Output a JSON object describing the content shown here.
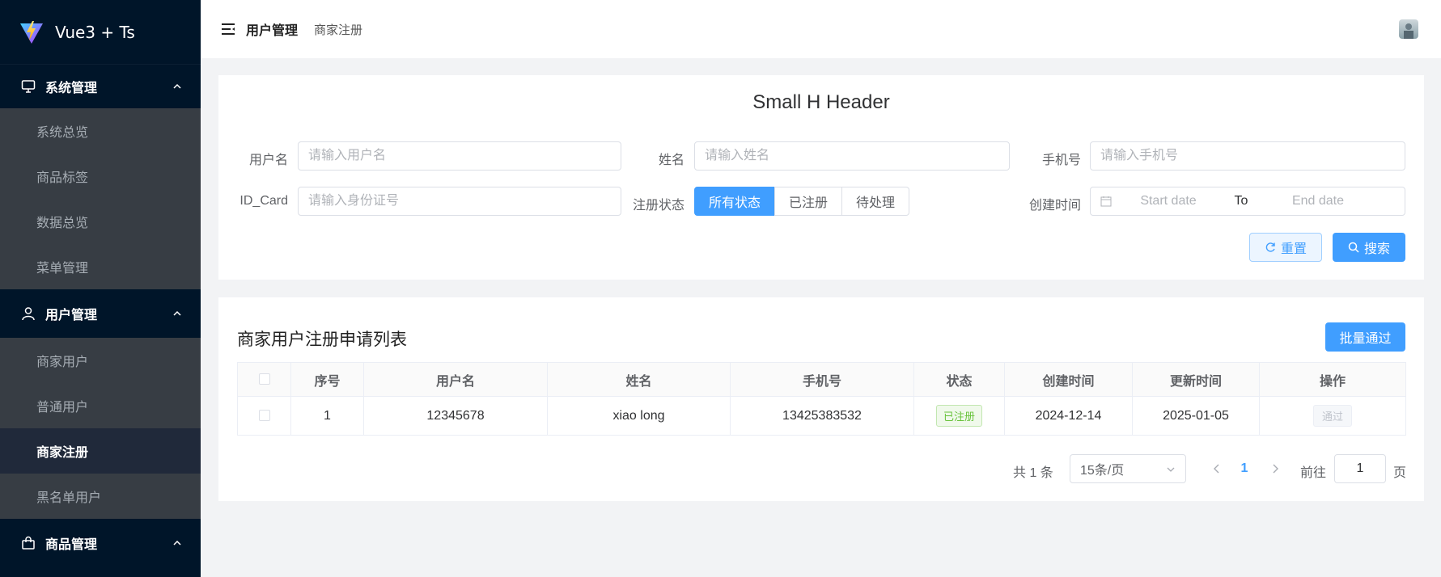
{
  "app": {
    "title": "Vue3 + Ts"
  },
  "sidebar": {
    "groups": [
      {
        "label": "系统管理",
        "icon": "monitor-icon",
        "items": [
          "系统总览",
          "商品标签",
          "数据总览",
          "菜单管理"
        ]
      },
      {
        "label": "用户管理",
        "icon": "user-icon",
        "items": [
          "商家用户",
          "普通用户",
          "商家注册",
          "黑名单用户"
        ],
        "active": "商家注册"
      },
      {
        "label": "商品管理",
        "icon": "shopping-bag-icon",
        "items": []
      }
    ]
  },
  "header": {
    "breadcrumb_main": "用户管理",
    "breadcrumb_sub": "商家注册"
  },
  "form": {
    "title": "Small H Header",
    "username_label": "用户名",
    "username_placeholder": "请输入用户名",
    "name_label": "姓名",
    "name_placeholder": "请输入姓名",
    "phone_label": "手机号",
    "phone_placeholder": "请输入手机号",
    "idcard_label": "ID_Card",
    "idcard_placeholder": "请输入身份证号",
    "status_label": "注册状态",
    "status_options": [
      "所有状态",
      "已注册",
      "待处理"
    ],
    "status_selected": "所有状态",
    "created_label": "创建时间",
    "date_start_placeholder": "Start date",
    "date_separator": "To",
    "date_end_placeholder": "End date",
    "reset_label": "重置",
    "search_label": "搜索"
  },
  "table": {
    "title": "商家用户注册申请列表",
    "batch_label": "批量通过",
    "columns": [
      "序号",
      "用户名",
      "姓名",
      "手机号",
      "状态",
      "创建时间",
      "更新时间",
      "操作"
    ],
    "rows": [
      {
        "index": "1",
        "username": "12345678",
        "name": "xiao long",
        "phone": "13425383532",
        "status": "已注册",
        "created": "2024-12-14",
        "updated": "2025-01-05",
        "action": "通过"
      }
    ]
  },
  "pagination": {
    "total_text": "共 1 条",
    "page_size": "15条/页",
    "current_page": "1",
    "goto_label": "前往",
    "goto_value": "1",
    "page_suffix": "页"
  },
  "colors": {
    "sidebar_bg": "#001529",
    "submenu_bg": "#373d44",
    "primary": "#409eff",
    "success": "#67c23a"
  }
}
